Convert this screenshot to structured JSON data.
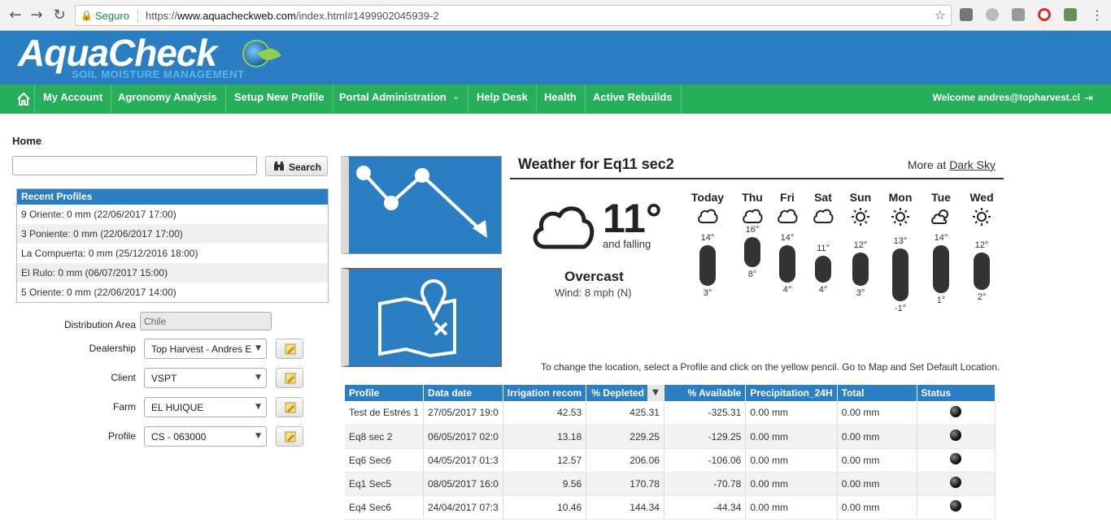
{
  "browser": {
    "secure_label": "Seguro",
    "url_scheme": "https://",
    "url_domain": "www.aquacheckweb.com",
    "url_path": "/index.html#1499902045939-2"
  },
  "header": {
    "logo_title": "AquaCheck",
    "logo_subtitle": "SOIL MOISTURE MANAGEMENT",
    "brand_color": "#2b7ec1",
    "nav_color": "#27ae5a"
  },
  "nav": {
    "items": [
      "My Account",
      "Agronomy Analysis",
      "Setup New Profile",
      "Portal Administration",
      "Help Desk",
      "Health",
      "Active Rebuilds"
    ],
    "welcome": "Welcome andres@topharvest.cl"
  },
  "left": {
    "page_title": "Home",
    "search_value": "",
    "search_label": "Search",
    "recent_header": "Recent Profiles",
    "recent": [
      "9 Oriente: 0 mm (22/06/2017 17:00)",
      "3 Poniente: 0 mm (22/06/2017 17:00)",
      "La Compuerta: 0 mm (25/12/2016 18:00)",
      "El Rulo: 0 mm (06/07/2017 15:00)",
      "5 Oriente: 0 mm (22/06/2017 14:00)"
    ],
    "distribution_label": "Distribution Area",
    "distribution_value": "Chile",
    "dealership_label": "Dealership",
    "dealership_value": "Top Harvest - Andres E",
    "client_label": "Client",
    "client_value": "VSPT",
    "farm_label": "Farm",
    "farm_value": "EL HUIQUE",
    "profile_label": "Profile",
    "profile_value": "CS - 063000"
  },
  "weather": {
    "title": "Weather for Eq11 sec2",
    "more_prefix": "More at",
    "more_link": "Dark Sky",
    "temp": "11°",
    "trend": "and falling",
    "condition": "Overcast",
    "wind": "Wind: 8 mph (N)",
    "days": [
      {
        "name": "Today",
        "icon": "cloud-icon",
        "hi": "14°",
        "lo": "3°",
        "hi_v": 14,
        "lo_v": 3
      },
      {
        "name": "Thu",
        "icon": "cloud-icon",
        "hi": "16°",
        "lo": "8°",
        "hi_v": 16,
        "lo_v": 8
      },
      {
        "name": "Fri",
        "icon": "cloud-icon",
        "hi": "14°",
        "lo": "4°",
        "hi_v": 14,
        "lo_v": 4
      },
      {
        "name": "Sat",
        "icon": "cloud-icon",
        "hi": "11°",
        "lo": "4°",
        "hi_v": 11,
        "lo_v": 4
      },
      {
        "name": "Sun",
        "icon": "sun-icon",
        "hi": "12°",
        "lo": "3°",
        "hi_v": 12,
        "lo_v": 3
      },
      {
        "name": "Mon",
        "icon": "sun-icon",
        "hi": "13°",
        "lo": "-1°",
        "hi_v": 13,
        "lo_v": -1
      },
      {
        "name": "Tue",
        "icon": "partly-cloudy-icon",
        "hi": "14°",
        "lo": "1°",
        "hi_v": 14,
        "lo_v": 1
      },
      {
        "name": "Wed",
        "icon": "sun-icon",
        "hi": "12°",
        "lo": "2°",
        "hi_v": 12,
        "lo_v": 2
      }
    ],
    "note": "To change the location, select a Profile and click on the yellow pencil. Go to Map and Set Default Location."
  },
  "table": {
    "headers": [
      "Profile",
      "Data date",
      "Irrigation recom",
      "% Depleted",
      "% Available",
      "Precipitation_24H",
      "Total",
      "Status"
    ],
    "rows": [
      [
        "Test de Estrés 1",
        "27/05/2017 19:0",
        "42.53",
        "425.31",
        "-325.31",
        "0.00 mm",
        "0.00 mm"
      ],
      [
        "Eq8 sec 2",
        "06/05/2017 02:0",
        "13.18",
        "229.25",
        "-129.25",
        "0.00 mm",
        "0.00 mm"
      ],
      [
        "Eq6 Sec6",
        "04/05/2017 01:3",
        "12.57",
        "206.06",
        "-106.06",
        "0.00 mm",
        "0.00 mm"
      ],
      [
        "Eq1 Sec5",
        "08/05/2017 16:0",
        "9.56",
        "170.78",
        "-70.78",
        "0.00 mm",
        "0.00 mm"
      ],
      [
        "Eq4 Sec6",
        "24/04/2017 07:3",
        "10.46",
        "144.34",
        "-44.34",
        "0.00 mm",
        "0.00 mm"
      ]
    ]
  }
}
